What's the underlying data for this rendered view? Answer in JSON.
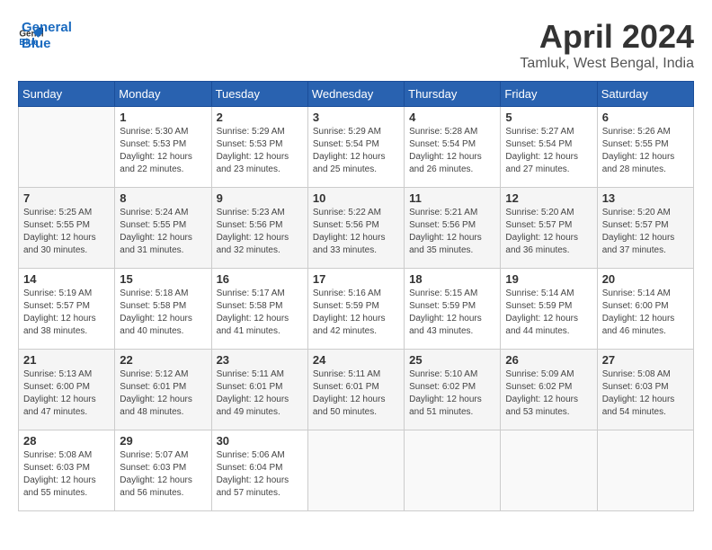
{
  "app": {
    "logo_line1": "General",
    "logo_line2": "Blue"
  },
  "title": "April 2024",
  "location": "Tamluk, West Bengal, India",
  "columns": [
    "Sunday",
    "Monday",
    "Tuesday",
    "Wednesday",
    "Thursday",
    "Friday",
    "Saturday"
  ],
  "weeks": [
    [
      {
        "day": "",
        "sunrise": "",
        "sunset": "",
        "daylight": ""
      },
      {
        "day": "1",
        "sunrise": "Sunrise: 5:30 AM",
        "sunset": "Sunset: 5:53 PM",
        "daylight": "Daylight: 12 hours and 22 minutes."
      },
      {
        "day": "2",
        "sunrise": "Sunrise: 5:29 AM",
        "sunset": "Sunset: 5:53 PM",
        "daylight": "Daylight: 12 hours and 23 minutes."
      },
      {
        "day": "3",
        "sunrise": "Sunrise: 5:29 AM",
        "sunset": "Sunset: 5:54 PM",
        "daylight": "Daylight: 12 hours and 25 minutes."
      },
      {
        "day": "4",
        "sunrise": "Sunrise: 5:28 AM",
        "sunset": "Sunset: 5:54 PM",
        "daylight": "Daylight: 12 hours and 26 minutes."
      },
      {
        "day": "5",
        "sunrise": "Sunrise: 5:27 AM",
        "sunset": "Sunset: 5:54 PM",
        "daylight": "Daylight: 12 hours and 27 minutes."
      },
      {
        "day": "6",
        "sunrise": "Sunrise: 5:26 AM",
        "sunset": "Sunset: 5:55 PM",
        "daylight": "Daylight: 12 hours and 28 minutes."
      }
    ],
    [
      {
        "day": "7",
        "sunrise": "Sunrise: 5:25 AM",
        "sunset": "Sunset: 5:55 PM",
        "daylight": "Daylight: 12 hours and 30 minutes."
      },
      {
        "day": "8",
        "sunrise": "Sunrise: 5:24 AM",
        "sunset": "Sunset: 5:55 PM",
        "daylight": "Daylight: 12 hours and 31 minutes."
      },
      {
        "day": "9",
        "sunrise": "Sunrise: 5:23 AM",
        "sunset": "Sunset: 5:56 PM",
        "daylight": "Daylight: 12 hours and 32 minutes."
      },
      {
        "day": "10",
        "sunrise": "Sunrise: 5:22 AM",
        "sunset": "Sunset: 5:56 PM",
        "daylight": "Daylight: 12 hours and 33 minutes."
      },
      {
        "day": "11",
        "sunrise": "Sunrise: 5:21 AM",
        "sunset": "Sunset: 5:56 PM",
        "daylight": "Daylight: 12 hours and 35 minutes."
      },
      {
        "day": "12",
        "sunrise": "Sunrise: 5:20 AM",
        "sunset": "Sunset: 5:57 PM",
        "daylight": "Daylight: 12 hours and 36 minutes."
      },
      {
        "day": "13",
        "sunrise": "Sunrise: 5:20 AM",
        "sunset": "Sunset: 5:57 PM",
        "daylight": "Daylight: 12 hours and 37 minutes."
      }
    ],
    [
      {
        "day": "14",
        "sunrise": "Sunrise: 5:19 AM",
        "sunset": "Sunset: 5:57 PM",
        "daylight": "Daylight: 12 hours and 38 minutes."
      },
      {
        "day": "15",
        "sunrise": "Sunrise: 5:18 AM",
        "sunset": "Sunset: 5:58 PM",
        "daylight": "Daylight: 12 hours and 40 minutes."
      },
      {
        "day": "16",
        "sunrise": "Sunrise: 5:17 AM",
        "sunset": "Sunset: 5:58 PM",
        "daylight": "Daylight: 12 hours and 41 minutes."
      },
      {
        "day": "17",
        "sunrise": "Sunrise: 5:16 AM",
        "sunset": "Sunset: 5:59 PM",
        "daylight": "Daylight: 12 hours and 42 minutes."
      },
      {
        "day": "18",
        "sunrise": "Sunrise: 5:15 AM",
        "sunset": "Sunset: 5:59 PM",
        "daylight": "Daylight: 12 hours and 43 minutes."
      },
      {
        "day": "19",
        "sunrise": "Sunrise: 5:14 AM",
        "sunset": "Sunset: 5:59 PM",
        "daylight": "Daylight: 12 hours and 44 minutes."
      },
      {
        "day": "20",
        "sunrise": "Sunrise: 5:14 AM",
        "sunset": "Sunset: 6:00 PM",
        "daylight": "Daylight: 12 hours and 46 minutes."
      }
    ],
    [
      {
        "day": "21",
        "sunrise": "Sunrise: 5:13 AM",
        "sunset": "Sunset: 6:00 PM",
        "daylight": "Daylight: 12 hours and 47 minutes."
      },
      {
        "day": "22",
        "sunrise": "Sunrise: 5:12 AM",
        "sunset": "Sunset: 6:01 PM",
        "daylight": "Daylight: 12 hours and 48 minutes."
      },
      {
        "day": "23",
        "sunrise": "Sunrise: 5:11 AM",
        "sunset": "Sunset: 6:01 PM",
        "daylight": "Daylight: 12 hours and 49 minutes."
      },
      {
        "day": "24",
        "sunrise": "Sunrise: 5:11 AM",
        "sunset": "Sunset: 6:01 PM",
        "daylight": "Daylight: 12 hours and 50 minutes."
      },
      {
        "day": "25",
        "sunrise": "Sunrise: 5:10 AM",
        "sunset": "Sunset: 6:02 PM",
        "daylight": "Daylight: 12 hours and 51 minutes."
      },
      {
        "day": "26",
        "sunrise": "Sunrise: 5:09 AM",
        "sunset": "Sunset: 6:02 PM",
        "daylight": "Daylight: 12 hours and 53 minutes."
      },
      {
        "day": "27",
        "sunrise": "Sunrise: 5:08 AM",
        "sunset": "Sunset: 6:03 PM",
        "daylight": "Daylight: 12 hours and 54 minutes."
      }
    ],
    [
      {
        "day": "28",
        "sunrise": "Sunrise: 5:08 AM",
        "sunset": "Sunset: 6:03 PM",
        "daylight": "Daylight: 12 hours and 55 minutes."
      },
      {
        "day": "29",
        "sunrise": "Sunrise: 5:07 AM",
        "sunset": "Sunset: 6:03 PM",
        "daylight": "Daylight: 12 hours and 56 minutes."
      },
      {
        "day": "30",
        "sunrise": "Sunrise: 5:06 AM",
        "sunset": "Sunset: 6:04 PM",
        "daylight": "Daylight: 12 hours and 57 minutes."
      },
      {
        "day": "",
        "sunrise": "",
        "sunset": "",
        "daylight": ""
      },
      {
        "day": "",
        "sunrise": "",
        "sunset": "",
        "daylight": ""
      },
      {
        "day": "",
        "sunrise": "",
        "sunset": "",
        "daylight": ""
      },
      {
        "day": "",
        "sunrise": "",
        "sunset": "",
        "daylight": ""
      }
    ]
  ]
}
